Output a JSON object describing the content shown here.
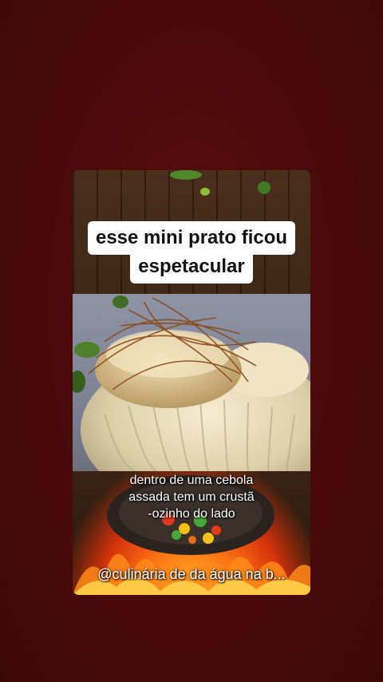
{
  "post": {
    "caption_line1": "esse mini prato ficou",
    "caption_line2": "espetacular",
    "subtitle_line1": "dentro de uma cebola",
    "subtitle_line2": "assada tem um crustã",
    "subtitle_line3": "-ozinho do lado",
    "handle": "@culinária de da água na b..."
  },
  "colors": {
    "page_background": "#4a0a0b",
    "caption_background": "#ffffff",
    "caption_text": "#111111",
    "subtitle_text": "#ffffff"
  },
  "icons": {
    "video_frame": "food-photo"
  }
}
